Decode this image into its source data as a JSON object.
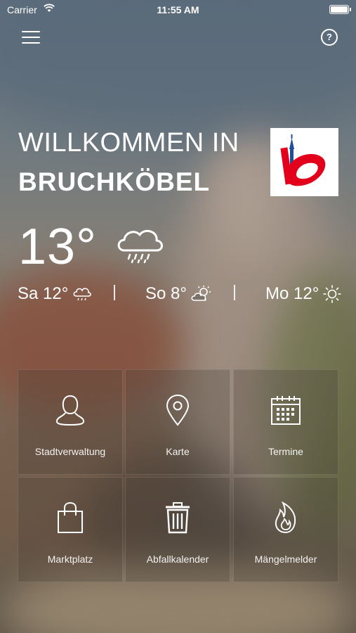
{
  "status_bar": {
    "carrier": "Carrier",
    "time": "11:55 AM"
  },
  "header": {
    "menu_icon": "hamburger-menu-icon",
    "help_icon": "question-mark-icon",
    "help_symbol": "?"
  },
  "welcome": {
    "line1": "WILLKOMMEN IN",
    "city": "BRUCHKÖBEL"
  },
  "weather": {
    "current_temp": "13°",
    "current_icon": "rain-cloud-icon",
    "forecast": [
      {
        "label": "Sa 12°",
        "icon": "rain-cloud-icon"
      },
      {
        "label": "So 8°",
        "icon": "partly-cloudy-icon"
      },
      {
        "label": "Mo 12°",
        "icon": "sun-icon"
      }
    ]
  },
  "tiles": [
    {
      "label": "Stadtverwaltung",
      "icon": "person-icon"
    },
    {
      "label": "Karte",
      "icon": "map-pin-icon"
    },
    {
      "label": "Termine",
      "icon": "calendar-icon"
    },
    {
      "label": "Marktplatz",
      "icon": "shopping-bag-icon"
    },
    {
      "label": "Abfallkalender",
      "icon": "trash-can-icon"
    },
    {
      "label": "Mängelmelder",
      "icon": "flame-icon"
    }
  ],
  "colors": {
    "logo_red": "#e2001a",
    "logo_blue": "#1d4f9c"
  }
}
